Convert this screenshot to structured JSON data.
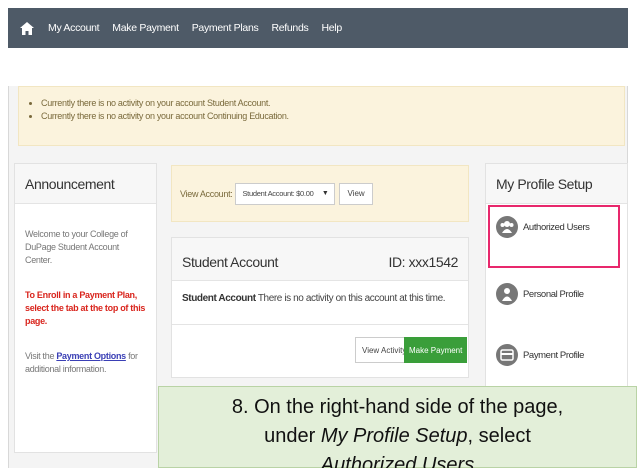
{
  "nav": {
    "items": [
      "My Account",
      "Make Payment",
      "Payment Plans",
      "Refunds",
      "Help"
    ]
  },
  "notices": [
    "Currently there is no activity on your account Student Account.",
    "Currently there is no activity on your account Continuing Education."
  ],
  "announcement": {
    "title": "Announcement",
    "welcome": "Welcome to your College of DuPage Student Account Center.",
    "enroll": "To Enroll in a Payment Plan, select the tab at the top of this page.",
    "visit_prefix": "Visit the ",
    "link": "Payment Options",
    "visit_suffix": " for additional information."
  },
  "view_account": {
    "label": "View Account:",
    "selected": "Student Account: $0.00",
    "button": "View"
  },
  "student_account": {
    "title": "Student Account",
    "id": "ID: xxx1542",
    "message_bold": "Student Account",
    "message": " There is no activity on this account at this time.",
    "view_activity": "View Activity",
    "make_payment": "Make Payment"
  },
  "profile": {
    "title": "My Profile Setup",
    "items": [
      "Authorized Users",
      "Personal Profile",
      "Payment Profile"
    ]
  },
  "callout": {
    "line1": "8. On the right-hand side of the page,",
    "line2_prefix": "under ",
    "line2_em": "My Profile Setup",
    "line2_suffix": ", select",
    "line3": "Authorized Users"
  },
  "colors": {
    "navbar": "#4e5a67",
    "notice_bg": "#fbf3dd",
    "accent_green": "#3a9e3a",
    "highlight": "#e8286c",
    "callout_bg": "#e3efd9"
  }
}
